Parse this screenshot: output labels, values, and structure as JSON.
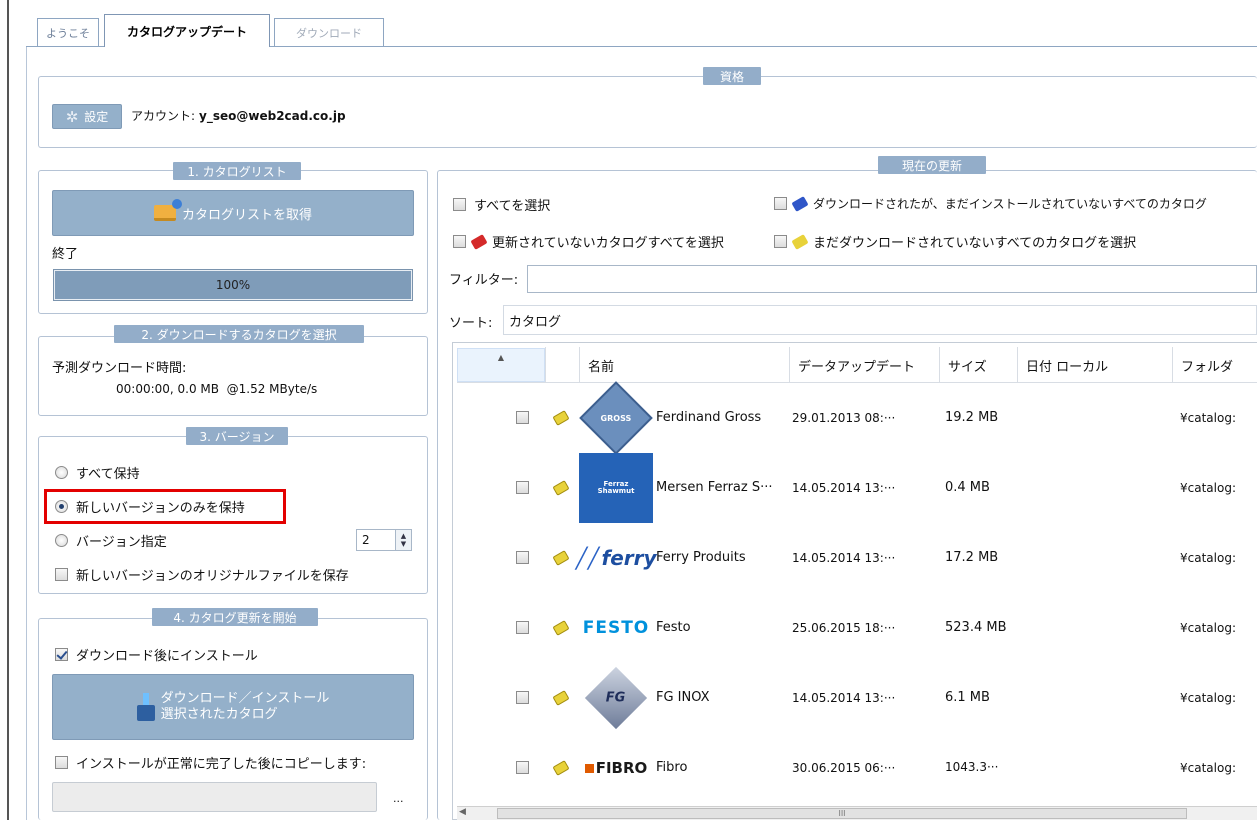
{
  "tabs": [
    {
      "label": "ようこそ"
    },
    {
      "label": "カタログアップデート"
    },
    {
      "label": "ダウンロード"
    }
  ],
  "credentials": {
    "legend": "資格",
    "settings_label": "設定",
    "account_label": "アカウント:",
    "account_value": "y_seo@web2cad.co.jp"
  },
  "catalog_list": {
    "legend": "1. カタログリスト",
    "get_button": "カタログリストを取得",
    "status": "終了",
    "progress_text": "100%",
    "progress": 1.0
  },
  "select_catalog": {
    "legend": "2. ダウンロードするカタログを選択",
    "estimate_label": "予測ダウンロード時間:",
    "estimate_value": "00:00:00, 0.0 MB  @1.52 MByte/s"
  },
  "version": {
    "legend": "3. バージョン",
    "keep_all": "すべて保持",
    "keep_new": "新しいバージョンのみを保持",
    "specify": "バージョン指定",
    "specify_value": "2",
    "save_original": "新しいバージョンのオリジナルファイルを保存"
  },
  "start": {
    "legend": "4. カタログ更新を開始",
    "install_after": "ダウンロード後にインストール",
    "download_button_line1": "ダウンロード／インストール",
    "download_button_line2": "選択されたカタログ",
    "copy_after": "インストールが正常に完了した後にコピーします:",
    "browse": "..."
  },
  "current": {
    "legend": "現在の更新",
    "select_all": "すべてを選択",
    "select_downloaded": "ダウンロードされたが、まだインストールされていないすべてのカタログ",
    "select_not_updated": "更新されていないカタログすべてを選択",
    "select_not_downloaded": "まだダウンロードされていないすべてのカタログを選択",
    "filter_label": "フィルター:",
    "filter_value": "",
    "sort_label": "ソート:",
    "sort_value": "カタログ"
  },
  "grid": {
    "columns": [
      "名前",
      "データアップデート",
      "サイズ",
      "日付 ローカル",
      "フォルダ"
    ],
    "rows": [
      {
        "name": "Ferdinand Gross",
        "date": "29.01.2013 08:···",
        "size": "19.2 MB",
        "local": "",
        "folder": "¥catalog:",
        "logo": "GROSS"
      },
      {
        "name": "Mersen Ferraz S···",
        "date": "14.05.2014 13:···",
        "size": "0.4 MB",
        "local": "",
        "folder": "¥catalog:",
        "logo": "Ferraz Shawmut"
      },
      {
        "name": "Ferry Produits",
        "date": "14.05.2014 13:···",
        "size": "17.2 MB",
        "local": "",
        "folder": "¥catalog:",
        "logo": "ferry"
      },
      {
        "name": "Festo",
        "date": "25.06.2015 18:···",
        "size": "523.4 MB",
        "local": "",
        "folder": "¥catalog:",
        "logo": "FESTO"
      },
      {
        "name": "FG INOX",
        "date": "14.05.2014 13:···",
        "size": "6.1 MB",
        "local": "",
        "folder": "¥catalog:",
        "logo": "FG"
      },
      {
        "name": "Fibro",
        "date": "30.06.2015 06:···",
        "size": "1043.3···",
        "local": "",
        "folder": "¥catalog:",
        "logo": "FIBRO"
      }
    ],
    "scroll_thumb": "III"
  },
  "colors": {
    "legend_bg": "#93adc9",
    "button_bg": "#94b0ca",
    "highlight": "#e30000",
    "festo": "#0091dc",
    "fibro": "#e05a00"
  }
}
